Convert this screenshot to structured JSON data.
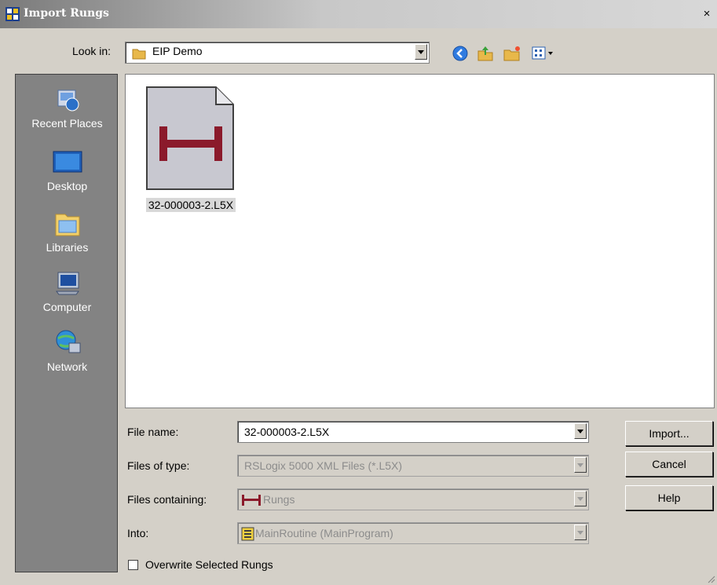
{
  "window": {
    "title": "Import Rungs",
    "close_label": "×"
  },
  "lookin": {
    "label": "Look in:",
    "value": "EIP Demo",
    "toolbar": [
      "back-icon",
      "up-folder-icon",
      "new-folder-icon",
      "view-menu-icon"
    ]
  },
  "places": [
    {
      "label": "Recent Places",
      "icon": "recent-places-icon"
    },
    {
      "label": "Desktop",
      "icon": "desktop-icon"
    },
    {
      "label": "Libraries",
      "icon": "libraries-icon"
    },
    {
      "label": "Computer",
      "icon": "computer-icon"
    },
    {
      "label": "Network",
      "icon": "network-icon"
    }
  ],
  "files": [
    {
      "name": "32-000003-2.L5X",
      "icon": "l5x-file-icon",
      "selected": true
    }
  ],
  "form": {
    "file_name_label": "File name:",
    "file_name_value": "32-000003-2.L5X",
    "files_of_type_label": "Files of type:",
    "files_of_type_value": "RSLogix 5000 XML Files (*.L5X)",
    "files_containing_label": "Files containing:",
    "files_containing_value": "Rungs",
    "into_label": "Into:",
    "into_value": "MainRoutine (MainProgram)"
  },
  "buttons": {
    "import": "Import...",
    "cancel": "Cancel",
    "help": "Help"
  },
  "overwrite": {
    "label": "Overwrite Selected Rungs",
    "checked": false
  },
  "colors": {
    "places_bg": "#838383",
    "dialog_bg": "#d4d0c8",
    "rung_icon": "#8b1a2b"
  }
}
